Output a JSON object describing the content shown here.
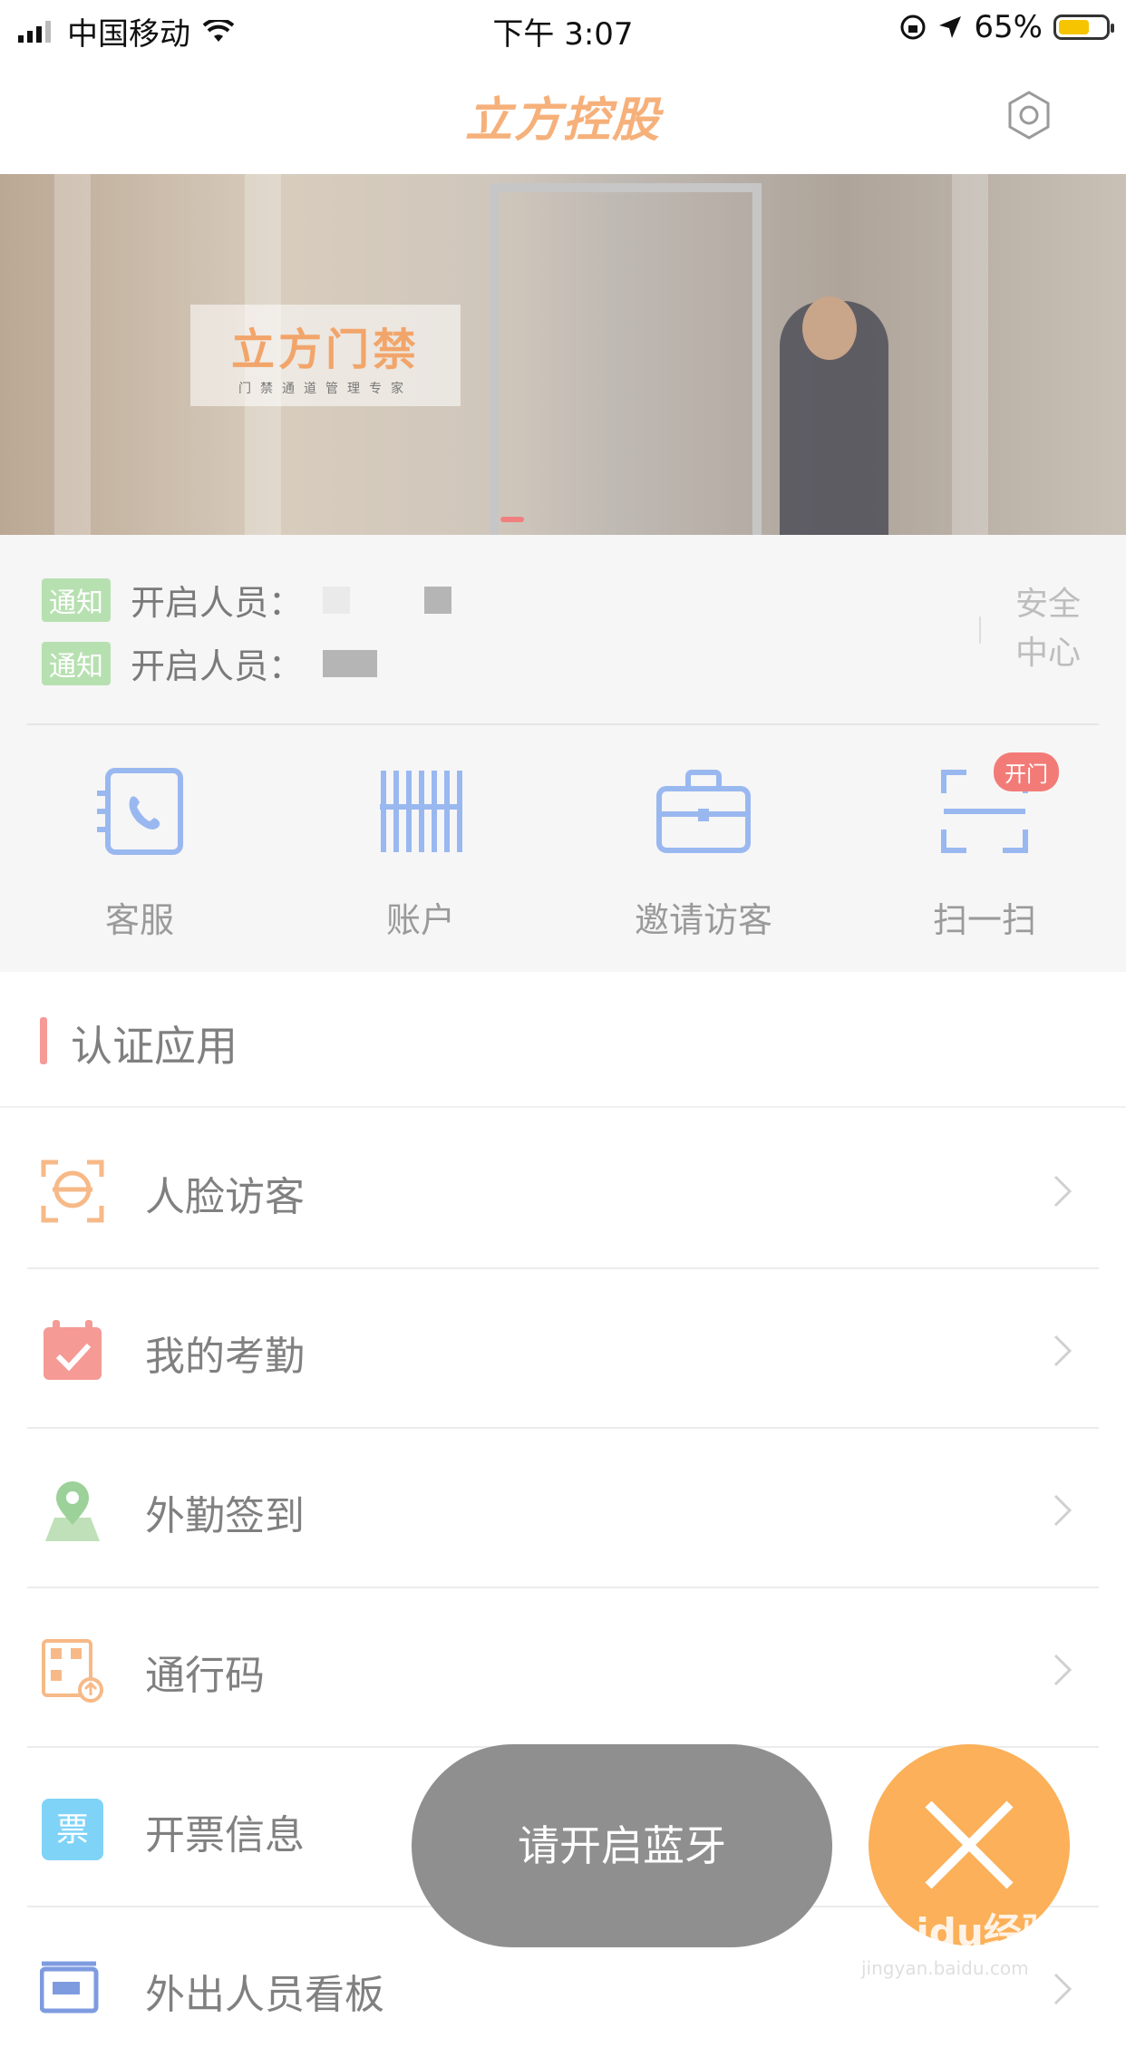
{
  "status_bar": {
    "carrier": "中国移动",
    "time": "下午 3:07",
    "battery_percent": "65%",
    "battery_level": 0.65
  },
  "header": {
    "logo_text": "立方控股",
    "settings_icon": "gear-icon"
  },
  "banner": {
    "sign_title": "立方门禁",
    "sign_subtitle": "门禁通道管理专家"
  },
  "notices": [
    {
      "tag": "通知",
      "text": "开启人员："
    },
    {
      "tag": "通知",
      "text": "开启人员："
    }
  ],
  "security_center": {
    "line1": "安全",
    "line2": "中心"
  },
  "quick_actions": [
    {
      "label": "客服",
      "icon": "phone-book-icon"
    },
    {
      "label": "账户",
      "icon": "barcode-icon"
    },
    {
      "label": "邀请访客",
      "icon": "briefcase-icon"
    },
    {
      "label": "扫一扫",
      "icon": "scan-icon",
      "badge": "开门"
    }
  ],
  "section": {
    "title": "认证应用"
  },
  "apps": [
    {
      "label": "人脸访客",
      "icon": "face-scan-icon"
    },
    {
      "label": "我的考勤",
      "icon": "calendar-check-icon"
    },
    {
      "label": "外勤签到",
      "icon": "location-pin-icon"
    },
    {
      "label": "通行码",
      "icon": "qr-code-icon"
    },
    {
      "label": "开票信息",
      "icon": "ticket-icon"
    },
    {
      "label": "外出人员看板",
      "icon": "board-icon"
    }
  ],
  "toast": {
    "text": "请开启蓝牙"
  },
  "watermark": {
    "brand": "Baidu经验",
    "url": "jingyan.baidu.com"
  },
  "colors": {
    "accent_orange": "#fbb059",
    "tag_green": "#b7e0b1",
    "badge_red": "#f37b77",
    "quick_icon_blue": "#9ab8f0"
  }
}
